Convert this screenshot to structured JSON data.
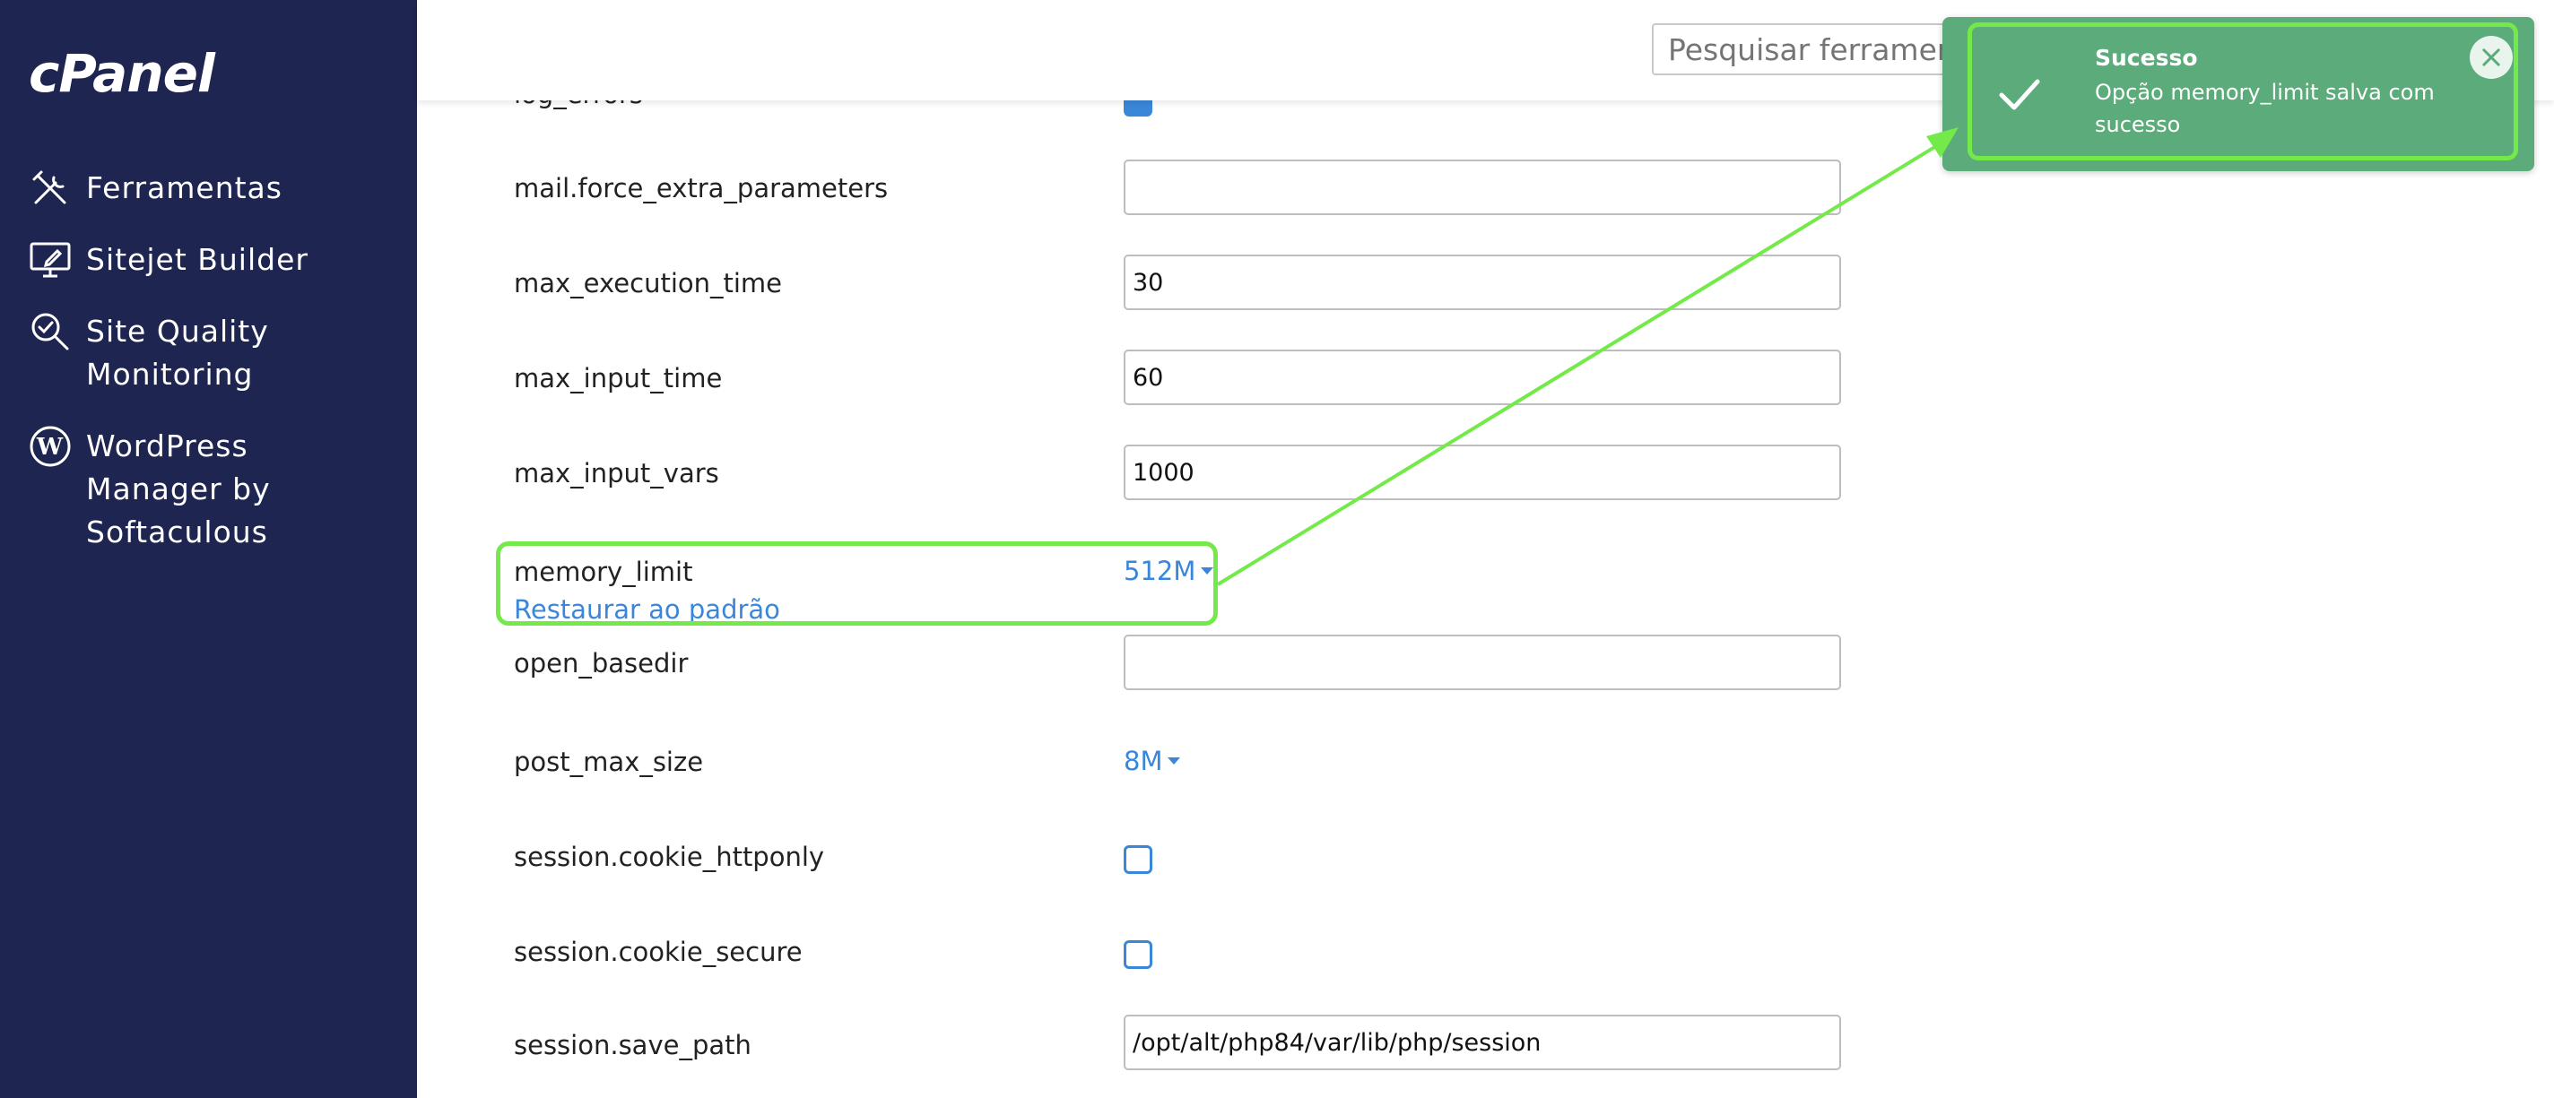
{
  "sidebar": {
    "logo": "cPanel",
    "items": [
      {
        "label": "Ferramentas",
        "icon": "tools-icon"
      },
      {
        "label": "Sitejet Builder",
        "icon": "monitor-edit-icon"
      },
      {
        "label": "Site Quality Monitoring",
        "label_line1": "Site Quality",
        "label_line2": "Monitoring",
        "icon": "magnifier-check-icon"
      },
      {
        "label": "WordPress Manager by Softaculous",
        "icon": "wordpress-icon"
      }
    ]
  },
  "search": {
    "placeholder": "Pesquisar ferramentas"
  },
  "settings": {
    "log_errors": {
      "label": "log_errors",
      "checked": true
    },
    "mail_force_extra_parameters": {
      "label": "mail.force_extra_parameters",
      "value": ""
    },
    "max_execution_time": {
      "label": "max_execution_time",
      "value": "30"
    },
    "max_input_time": {
      "label": "max_input_time",
      "value": "60"
    },
    "max_input_vars": {
      "label": "max_input_vars",
      "value": "1000"
    },
    "memory_limit": {
      "label": "memory_limit",
      "value": "512M",
      "reset_link": "Restaurar ao padrão"
    },
    "open_basedir": {
      "label": "open_basedir",
      "value": ""
    },
    "post_max_size": {
      "label": "post_max_size",
      "value": "8M"
    },
    "session_cookie_httponly": {
      "label": "session.cookie_httponly",
      "checked": false
    },
    "session_cookie_secure": {
      "label": "session.cookie_secure",
      "checked": false
    },
    "session_save_path": {
      "label": "session.save_path",
      "value": "/opt/alt/php84/var/lib/php/session"
    }
  },
  "toast": {
    "title": "Sucesso",
    "message": "Opção memory_limit salva com sucesso"
  },
  "colors": {
    "sidebar": "#1f2551",
    "accent": "#3a87d9",
    "toast": "#5cab7a",
    "annotation": "#74ea4a"
  }
}
